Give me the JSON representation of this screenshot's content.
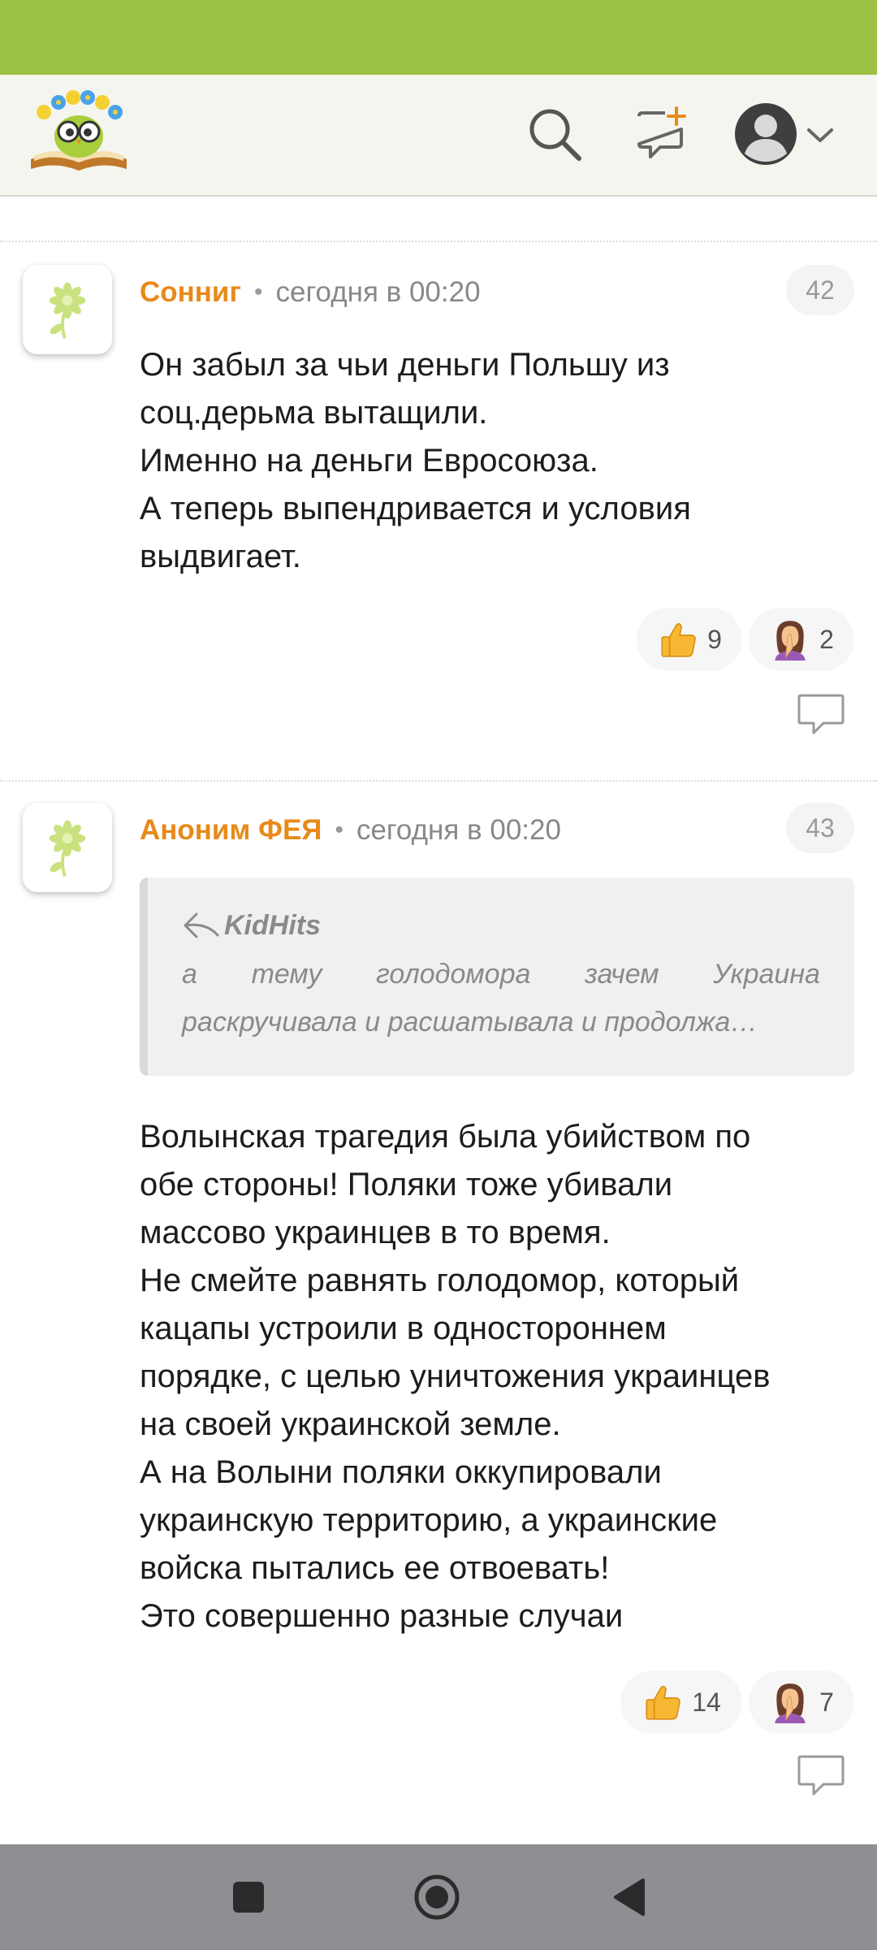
{
  "comments": [
    {
      "author": "Сонниг",
      "time": "сегодня в 00:20",
      "number": "42",
      "lines": [
        "Он забыл за чьи деньги Польшу из",
        "соц.дерьма вытащили.",
        "Именно на деньги Евросоюза.",
        "А теперь выпендривается и условия",
        "выдвигает."
      ],
      "likes": "9",
      "facepalms": "2"
    },
    {
      "author": "Аноним ФЕЯ",
      "time": "сегодня в 00:20",
      "number": "43",
      "quote": {
        "author": "KidHits",
        "line1_words": [
          "а",
          "тему",
          "голодомора",
          "зачем",
          "Украина"
        ],
        "line2": "раскручивала и расшатывала и продолжа…"
      },
      "lines": [
        "Волынская трагедия была убийством по",
        "обе стороны! Поляки тоже убивали",
        "массово украинцев в то время.",
        "Не смейте равнять голодомор, который",
        "кацапы устроили в одностороннем",
        "порядке, с целью уничтожения украинцев",
        "на своей украинской земле.",
        "А на Волыни поляки оккупировали",
        "украинскую территорию, а украинские",
        "войска пытались ее отвоевать!",
        "Это совершенно разные случаи"
      ],
      "likes": "14",
      "facepalms": "7"
    }
  ],
  "colors": {
    "status_bar": "#9dc142",
    "author": "#e88a1a",
    "header_bg": "#f5f5f0",
    "nav_bar": "#8e8e93"
  },
  "icons": {
    "logo": "owl-with-flowers-on-book-logo",
    "search": "search-icon",
    "new_post": "new-message-icon",
    "profile": "profile-avatar-icon",
    "dropdown": "chevron-down-icon",
    "avatar": "daisy-flower-icon",
    "like": "thumbs-up-icon",
    "facepalm": "facepalm-icon",
    "reply": "reply-bubble-icon",
    "quote_reply": "reply-arrow-icon",
    "nav_recents": "square-icon",
    "nav_home": "circle-icon",
    "nav_back": "triangle-back-icon"
  }
}
